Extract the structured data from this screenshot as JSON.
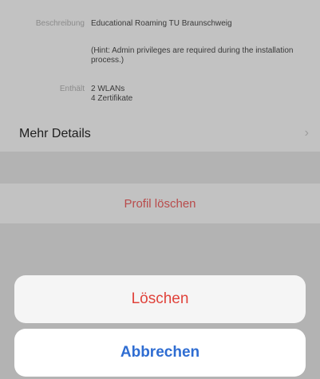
{
  "details": {
    "description_label": "Beschreibung",
    "description_value": "Educational Roaming TU Braunschweig",
    "hint": "(Hint: Admin privileges are required during the installation process.)",
    "contains_label": "Enthält",
    "contains_values": [
      "2 WLANs",
      "4 Zertifikate"
    ]
  },
  "more_details": {
    "label": "Mehr Details",
    "chevron": "›"
  },
  "profile_delete": {
    "label": "Profil löschen"
  },
  "action_sheet": {
    "delete_label": "Löschen",
    "cancel_label": "Abbrechen"
  },
  "colors": {
    "delete_red": "#e0433b",
    "cancel_blue": "#2f6dd2",
    "overlay_gray": "#bdbdbd"
  }
}
